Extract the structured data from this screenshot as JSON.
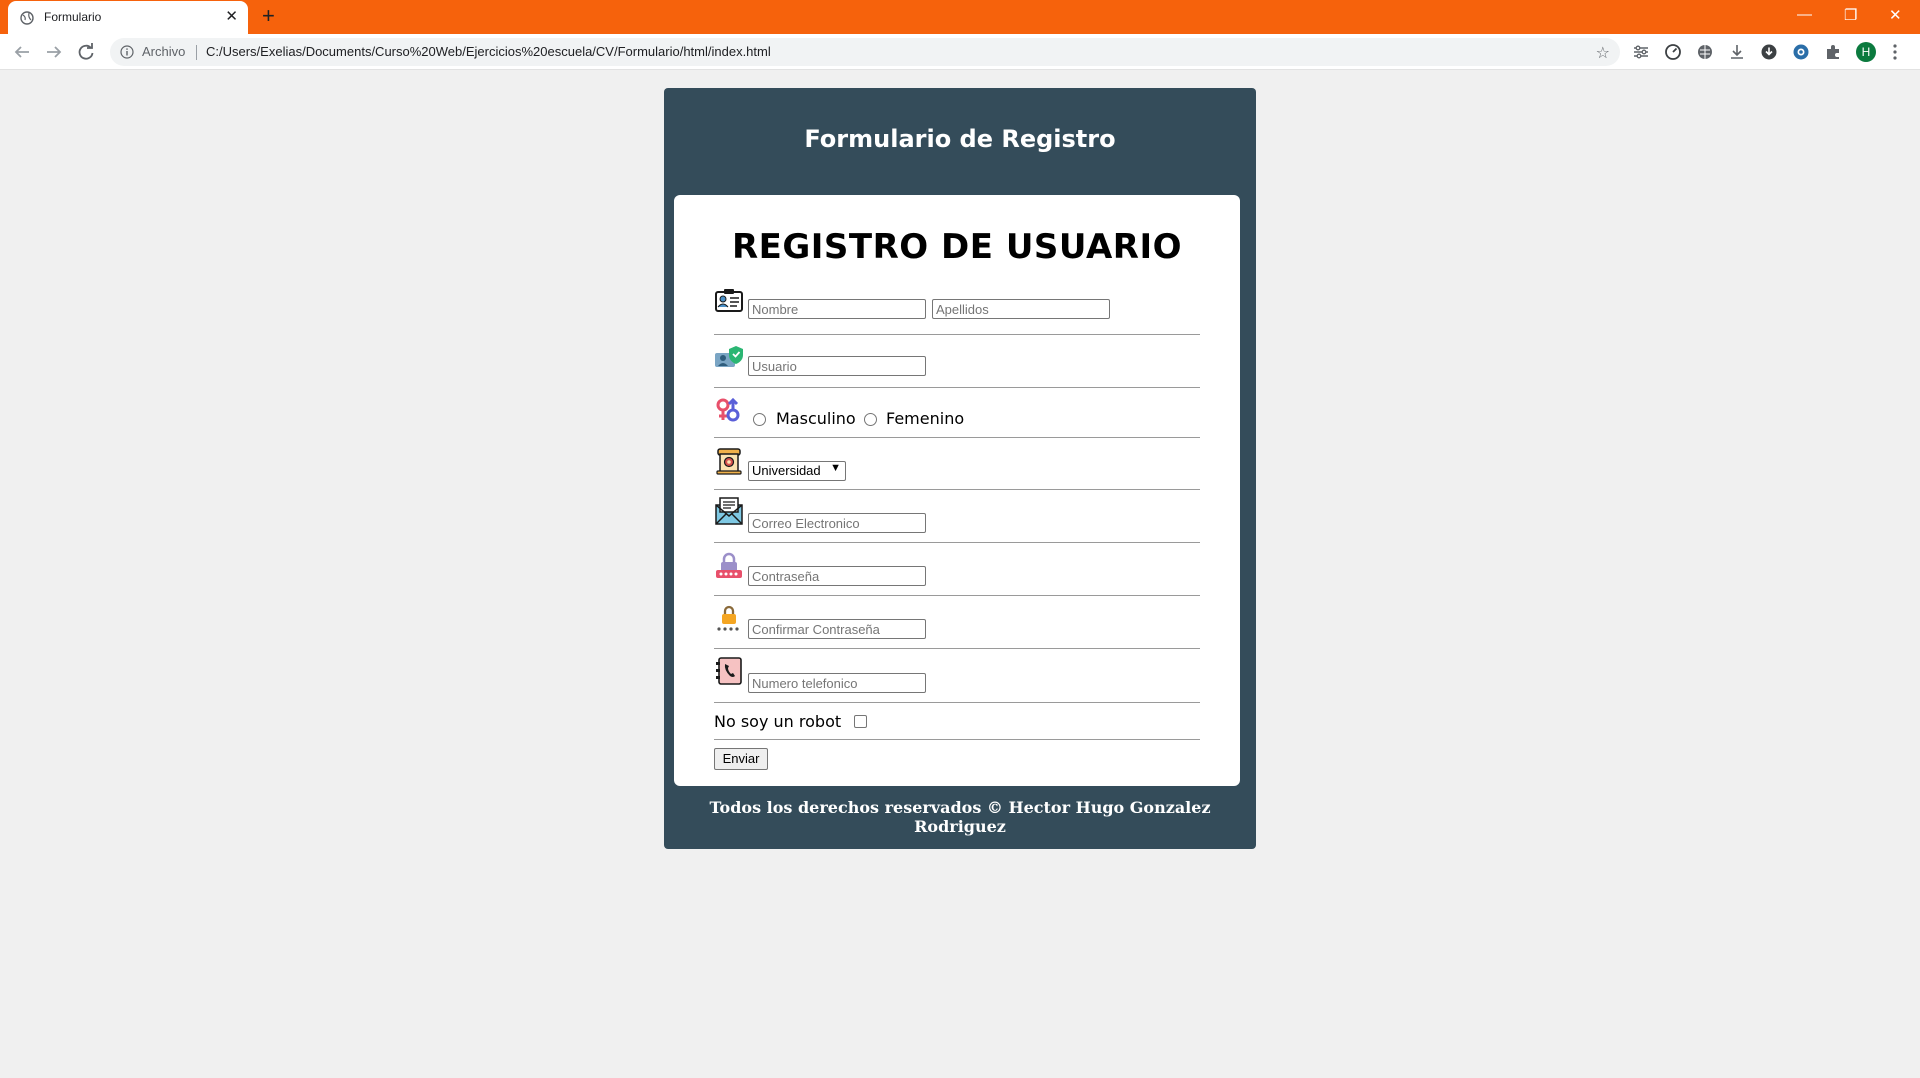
{
  "browser": {
    "tab_title": "Formulario",
    "tab_close": "✕",
    "new_tab": "+",
    "window_controls": {
      "minimize": "—",
      "restore": "❐",
      "close": "✕"
    },
    "address": {
      "scheme_label": "Archivo",
      "url": "C:/Users/Exelias/Documents/Curso%20Web/Ejercicios%20escuela/CV/Formulario/html/index.html"
    },
    "profile_initial": "H",
    "accent_color": "#f6620c"
  },
  "page": {
    "header_title": "Formulario de Registro",
    "form_title": "REGISTRO DE USUARIO",
    "fields": {
      "nombre_placeholder": "Nombre",
      "apellidos_placeholder": "Apellidos",
      "usuario_placeholder": "Usuario",
      "gender_male": "Masculino",
      "gender_female": "Femenino",
      "education_selected": "Universidad",
      "email_placeholder": "Correo Electronico",
      "password_placeholder": "Contraseña",
      "confirm_password_placeholder": "Confirmar Contraseña",
      "phone_placeholder": "Numero telefonico"
    },
    "robot_label": "No soy un robot",
    "submit_label": "Enviar",
    "footer": "Todos los derechos reservados © Hector Hugo Gonzalez Rodriguez",
    "colors": {
      "card_bg": "#344c5a",
      "page_bg": "#f0f0f0",
      "form_bg": "#ffffff"
    }
  }
}
